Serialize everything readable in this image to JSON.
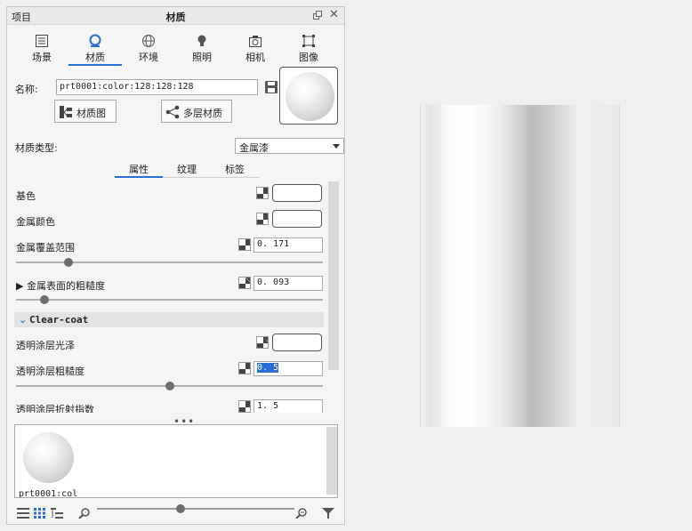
{
  "titlebar": {
    "left": "项目",
    "title": "材质"
  },
  "tabs": [
    {
      "label": "场景",
      "icon": "scene-list-icon"
    },
    {
      "label": "材质",
      "icon": "material-icon"
    },
    {
      "label": "环境",
      "icon": "globe-icon"
    },
    {
      "label": "照明",
      "icon": "lightbulb-icon"
    },
    {
      "label": "相机",
      "icon": "camera-icon"
    },
    {
      "label": "图像",
      "icon": "image-crop-icon"
    }
  ],
  "active_tab": "材质",
  "name_label": "名称:",
  "name_value": "prt0001:color:128:128:128",
  "buttons": {
    "material_graph": "材质图",
    "multilayer": "多层材质"
  },
  "material_type_label": "材质类型:",
  "material_type_value": "金属漆",
  "subtabs": [
    "属性",
    "纹理",
    "标签"
  ],
  "properties": {
    "base_color": "基色",
    "metal_color": "金属颜色",
    "metal_coverage": "金属覆盖范围",
    "metal_coverage_value": "0. 171",
    "metal_roughness": "金属表面的粗糙度",
    "metal_roughness_value": "0. 093",
    "clearcoat_section": "Clear-coat",
    "clearcoat_gloss": "透明涂层光泽",
    "clearcoat_roughness": "透明涂层粗糙度",
    "clearcoat_roughness_value": "0. 5",
    "clearcoat_ior": "透明涂层折射指数",
    "clearcoat_ior_value": "1. 5"
  },
  "slider_levels": {
    "metal_coverage": 0.171,
    "metal_roughness": 0.093,
    "clearcoat_roughness": 0.5
  },
  "library_item_label": "prt0001:col",
  "colors": {
    "accent": "#2a6fd6"
  }
}
